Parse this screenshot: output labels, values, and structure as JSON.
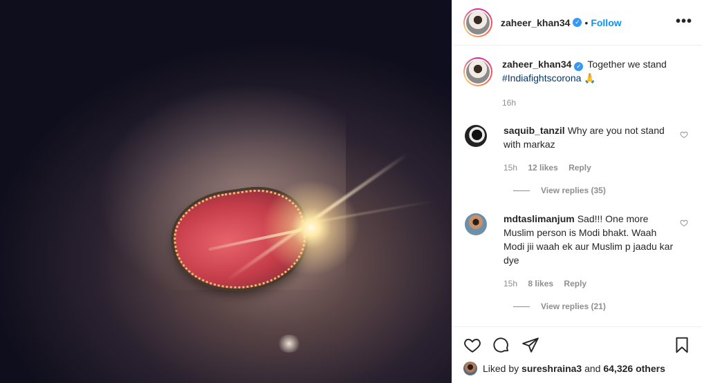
{
  "post": {
    "author": "zaheer_khan34",
    "follow_label": "Follow",
    "dot": "•",
    "more_label": "•••"
  },
  "caption": {
    "user": "zaheer_khan34",
    "text": "Together we stand",
    "hashtag": "#Indiafightscorona",
    "emoji": "🙏",
    "time": "16h"
  },
  "comments": [
    {
      "user": "saquib_tanzil",
      "text": "Why are you not stand with markaz",
      "time": "15h",
      "likes": "12 likes",
      "reply": "Reply",
      "view_replies": "View replies (35)"
    },
    {
      "user": "mdtaslimanjum",
      "text": "Sad!!! One more Muslim person is Modi bhakt. Waah Modi jii waah ek aur Muslim p jaadu kar dye",
      "time": "15h",
      "likes": "8 likes",
      "reply": "Reply",
      "view_replies": "View replies (21)"
    }
  ],
  "likes_bar": {
    "prefix": "Liked by",
    "user": "sureshraina3",
    "and": "and",
    "others": "64,326 others"
  },
  "colors": {
    "accent": "#0095f6",
    "verified": "#3897f0",
    "muted": "#8e8e8e"
  }
}
